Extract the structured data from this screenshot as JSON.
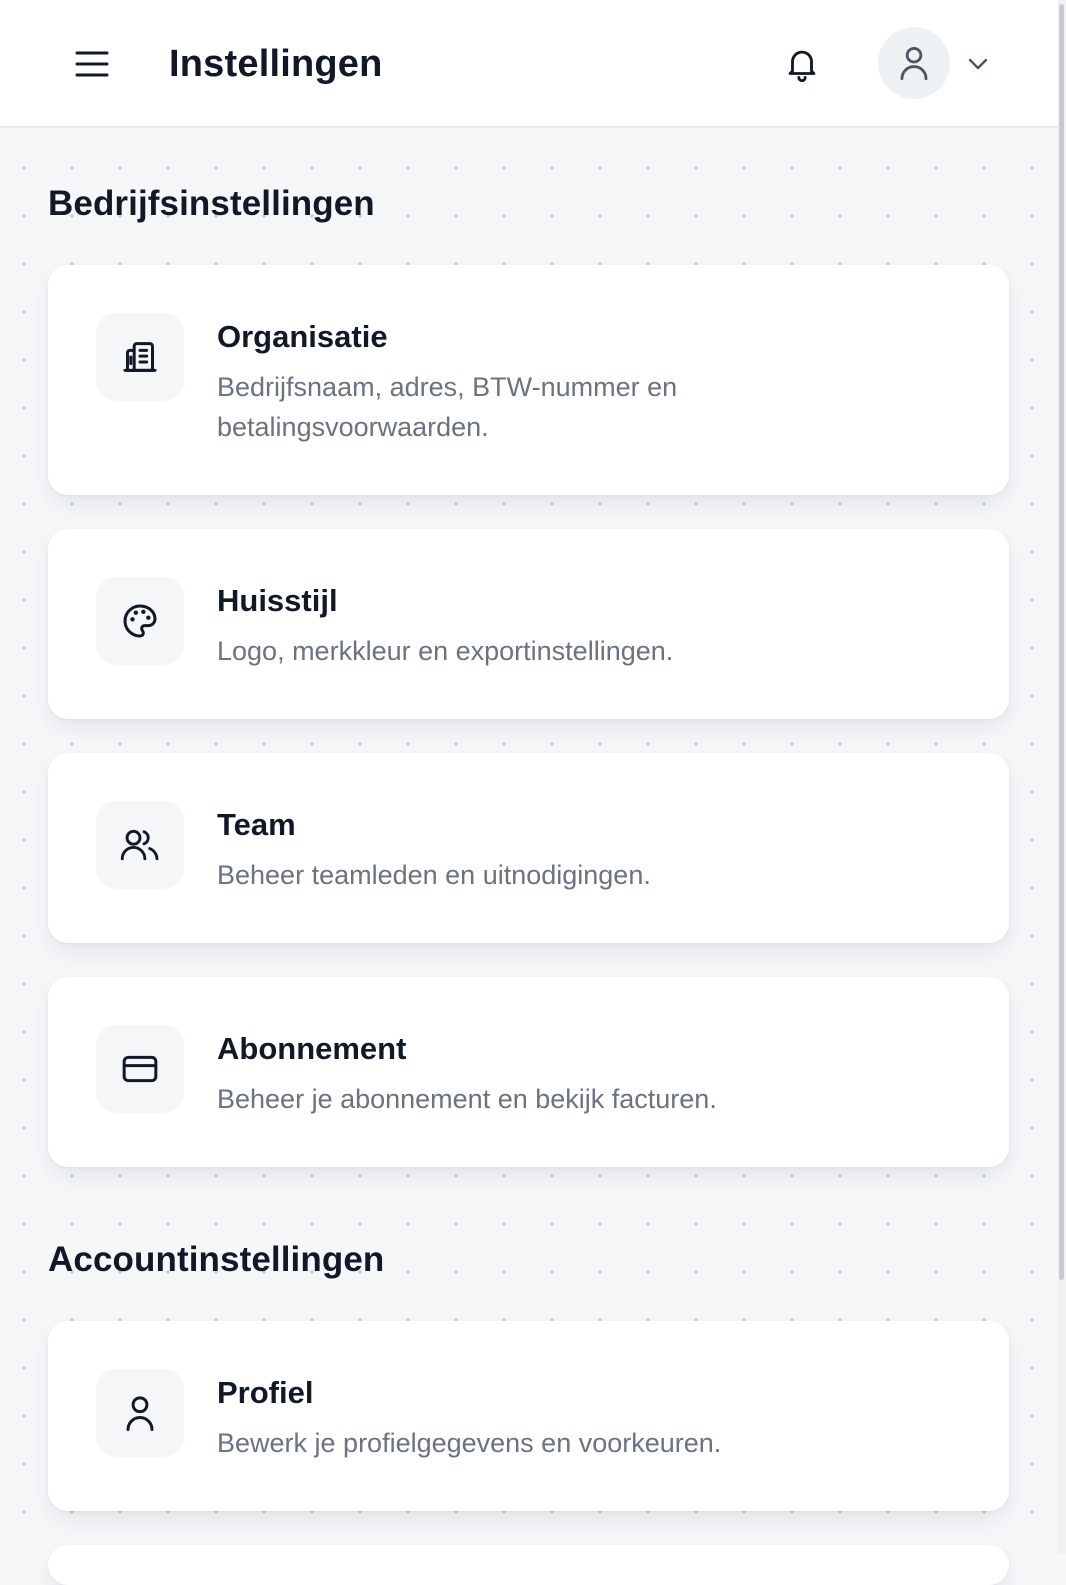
{
  "header": {
    "title": "Instellingen",
    "menu_icon": "menu-icon",
    "notification_icon": "bell-icon",
    "avatar_icon": "user-icon",
    "dropdown_icon": "chevron-down-icon"
  },
  "sections": [
    {
      "title": "Bedrijfsinstellingen",
      "cards": [
        {
          "title": "Organisatie",
          "description": "Bedrijfsnaam, adres, BTW-nummer en betalingsvoorwaarden.",
          "icon": "building-icon"
        },
        {
          "title": "Huisstijl",
          "description": "Logo, merkkleur en exportinstellingen.",
          "icon": "palette-icon"
        },
        {
          "title": "Team",
          "description": "Beheer teamleden en uitnodigingen.",
          "icon": "users-icon"
        },
        {
          "title": "Abonnement",
          "description": "Beheer je abonnement en bekijk facturen.",
          "icon": "credit-card-icon"
        }
      ]
    },
    {
      "title": "Accountinstellingen",
      "cards": [
        {
          "title": "Profiel",
          "description": "Bewerk je profielgegevens en voorkeuren.",
          "icon": "user-icon"
        }
      ]
    }
  ],
  "colors": {
    "background": "#f5f7f9",
    "card": "#ffffff",
    "text_primary": "#111827",
    "text_secondary": "#6b7280"
  }
}
